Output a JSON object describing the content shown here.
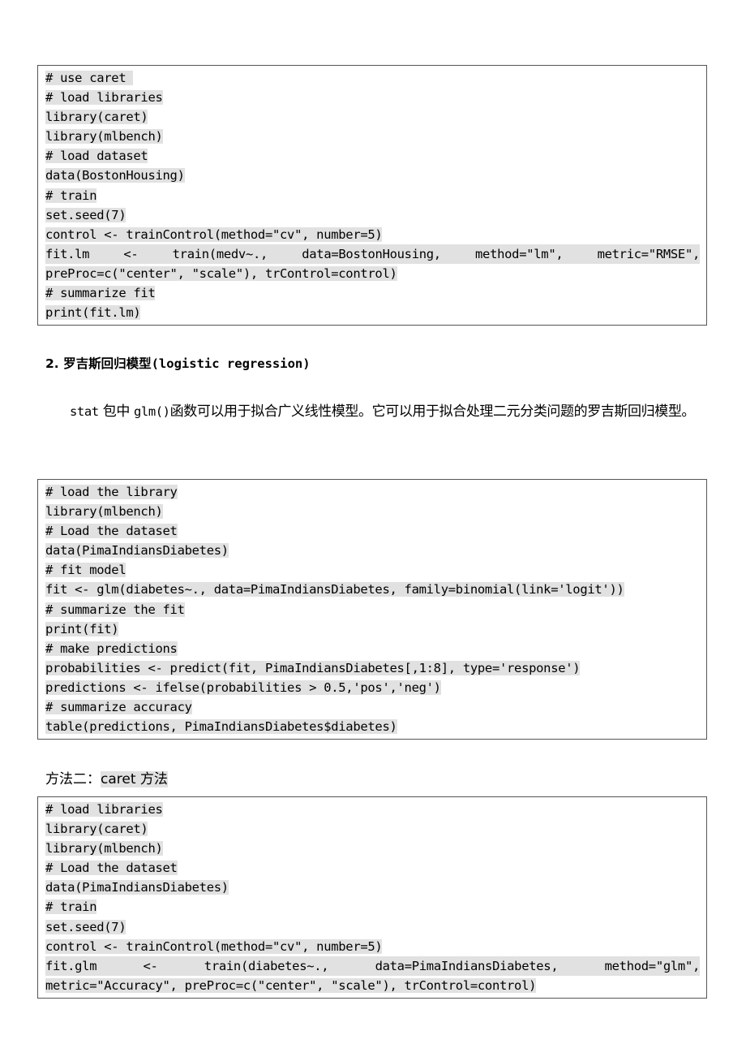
{
  "code_block_1": {
    "lines": [
      "# use caret ",
      "# load libraries",
      "library(caret)",
      "library(mlbench)",
      "# load dataset",
      "data(BostonHousing)",
      "# train",
      "set.seed(7)",
      "control <- trainControl(method=\"cv\", number=5)",
      [
        "fit.lm",
        "<-",
        "train(medv~.,",
        "data=BostonHousing,",
        "method=\"lm\",",
        "metric=\"RMSE\","
      ],
      "preProc=c(\"center\", \"scale\"), trControl=control)",
      "# summarize fit",
      "print(fit.lm)"
    ]
  },
  "section_2": {
    "number": "2. ",
    "title_cn": "罗吉斯回归模型",
    "title_en": "(logistic regression)"
  },
  "paragraph_1": {
    "part1": "stat",
    "part2": " 包中 ",
    "part3": "glm()",
    "part4": "函数可以用于拟合广义线性模型。它可以用于拟合处理二元分类问题的罗吉斯回归模型。"
  },
  "code_block_2": {
    "lines": [
      "# load the library",
      "library(mlbench)",
      "# Load the dataset",
      "data(PimaIndiansDiabetes)",
      "# fit model",
      "fit <- glm(diabetes~., data=PimaIndiansDiabetes, family=binomial(link='logit'))",
      "# summarize the fit",
      "print(fit)",
      "# make predictions",
      "probabilities <- predict(fit, PimaIndiansDiabetes[,1:8], type='response')",
      "predictions <- ifelse(probabilities > 0.5,'pos','neg')",
      "# summarize accuracy",
      "table(predictions, PimaIndiansDiabetes$diabetes)"
    ]
  },
  "method_2": {
    "prefix": "方法二：",
    "highlight": "caret 方法"
  },
  "code_block_3": {
    "lines": [
      "# load libraries",
      "library(caret)",
      "library(mlbench)",
      "# Load the dataset",
      "data(PimaIndiansDiabetes)",
      "# train",
      "set.seed(7)",
      "control <- trainControl(method=\"cv\", number=5)",
      [
        "fit.glm",
        "<-",
        "train(diabetes~.,",
        "data=PimaIndiansDiabetes,",
        "method=\"glm\","
      ],
      "metric=\"Accuracy\", preProc=c(\"center\", \"scale\"), trControl=control)"
    ]
  }
}
